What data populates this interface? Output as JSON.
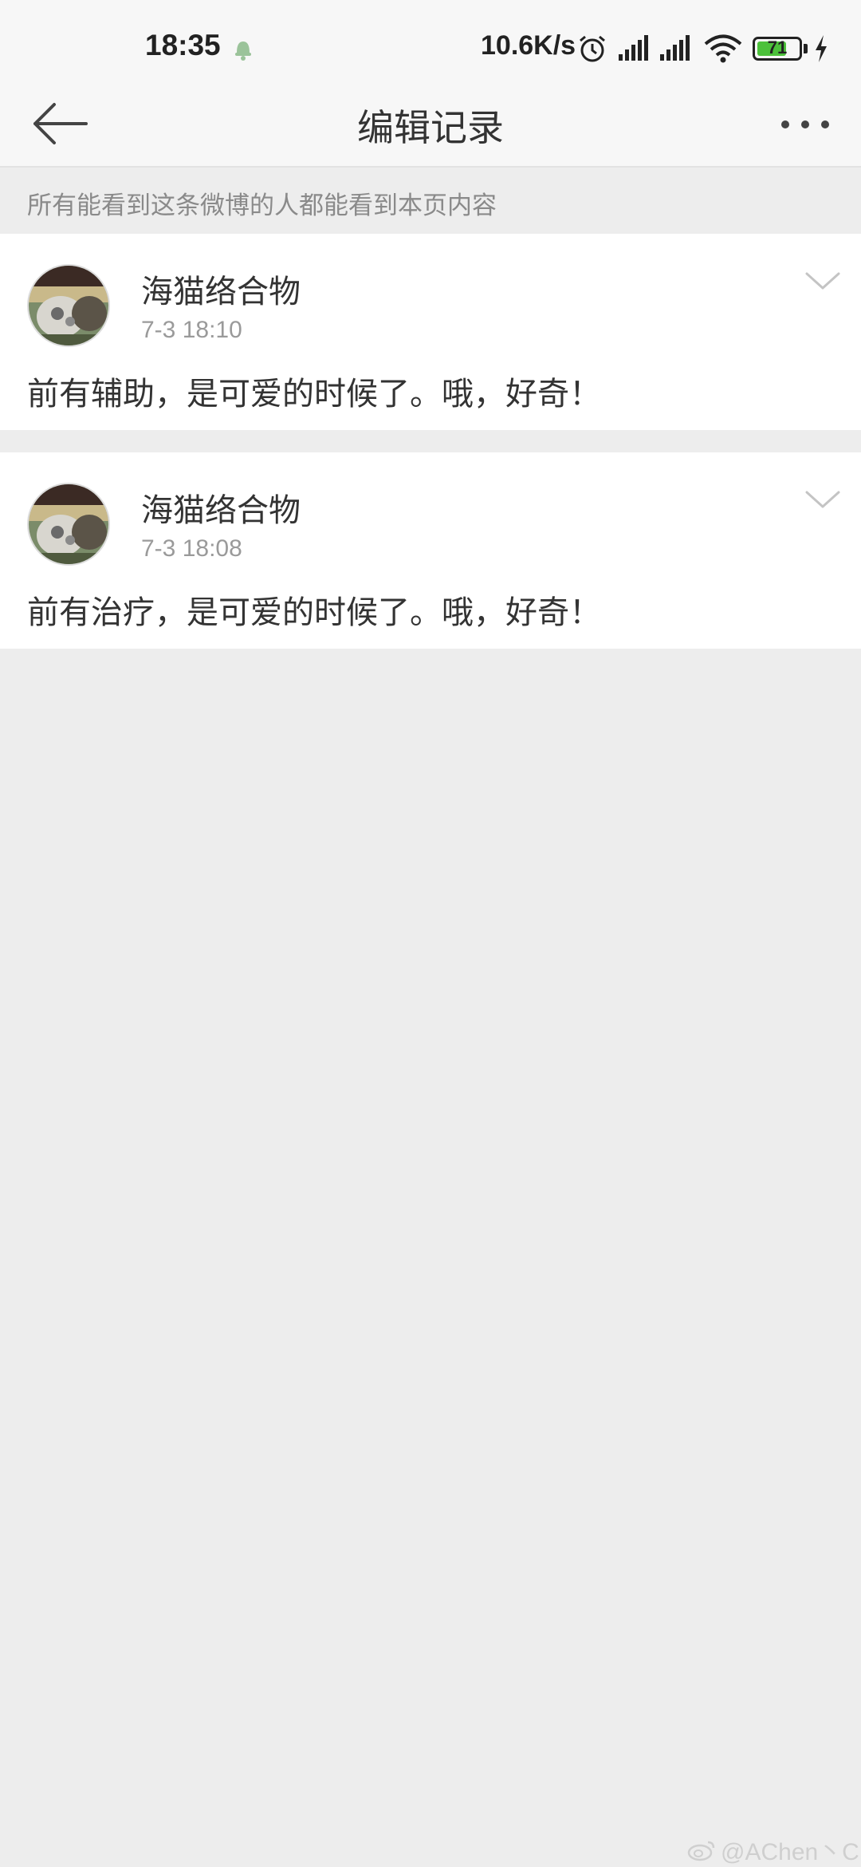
{
  "status_bar": {
    "time": "18:35",
    "network_speed": "10.6K/s",
    "battery_level": "71",
    "battery_fraction": 0.71,
    "icons": [
      "notification-icon",
      "alarm-icon",
      "signal-icon",
      "signal-icon",
      "wifi-icon",
      "battery-icon",
      "charging-icon"
    ]
  },
  "header": {
    "title": "编辑记录",
    "back_icon": "arrow-left-icon",
    "more_icon": "more-dots-icon"
  },
  "notice": "所有能看到这条微博的人都能看到本页内容",
  "records": [
    {
      "author": "海猫络合物",
      "time": "7-3 18:10",
      "content": "前有辅助，是可爱的时候了。哦，好奇！"
    },
    {
      "author": "海猫络合物",
      "time": "7-3 18:08",
      "content": "前有治疗，是可爱的时候了。哦，好奇！"
    }
  ],
  "watermark": "@AChen丶C",
  "colors": {
    "background": "#ededed",
    "card": "#ffffff",
    "battery_green": "#4cc13b"
  }
}
